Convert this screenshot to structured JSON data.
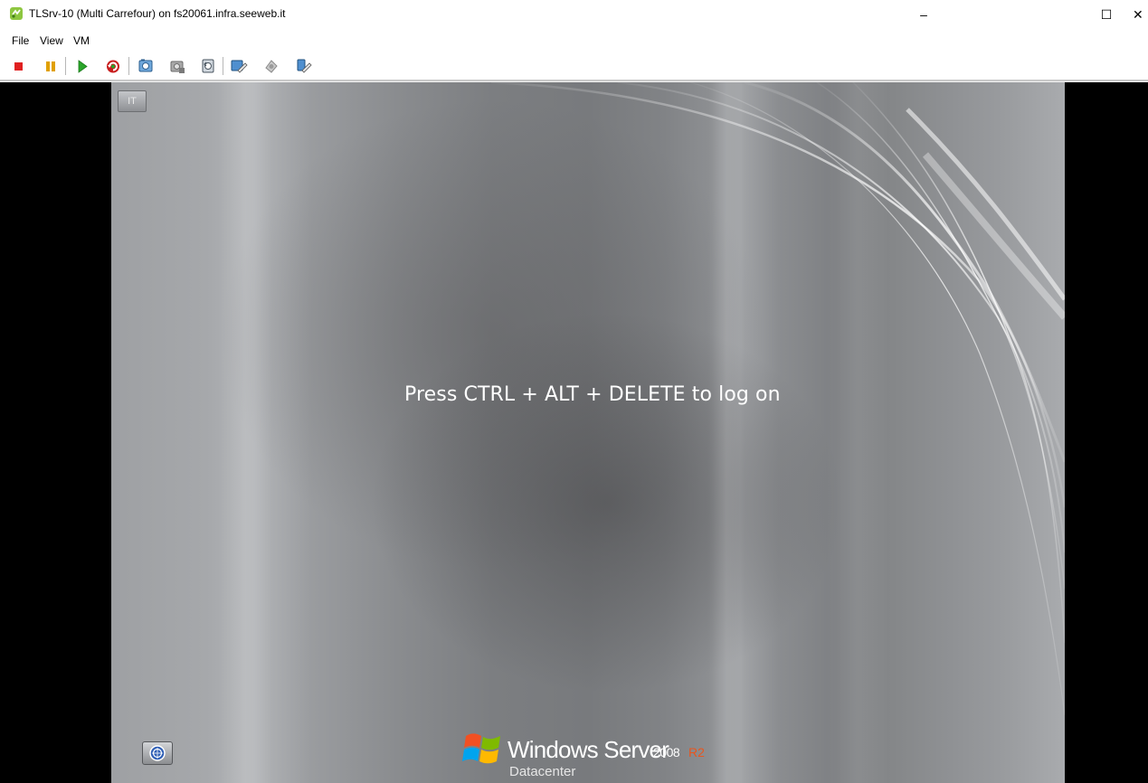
{
  "window": {
    "title": "TLSrv-10 (Multi Carrefour) on fs20061.infra.seeweb.it",
    "minimize_glyph": "–",
    "maximize_glyph": "☐",
    "close_glyph": "✕"
  },
  "menu": {
    "items": [
      {
        "label": "File"
      },
      {
        "label": "View"
      },
      {
        "label": "VM"
      }
    ]
  },
  "toolbar": {
    "buttons": [
      {
        "icon": "stop-icon",
        "color": "#e02020"
      },
      {
        "icon": "pause-icon",
        "color": "#e0a000"
      },
      {
        "icon": "play-icon",
        "color": "#2aa52a"
      },
      {
        "icon": "reset-icon",
        "color": "#c81e1e"
      },
      {
        "icon": "snapshot-icon"
      },
      {
        "icon": "snapshot-manager-icon"
      },
      {
        "icon": "revert-icon"
      },
      {
        "icon": "edit-settings-icon"
      },
      {
        "icon": "connect-device-icon"
      },
      {
        "icon": "device-settings-icon"
      }
    ]
  },
  "vm_screen": {
    "language_indicator": "IT",
    "logon_prompt": "Press CTRL + ALT + DELETE to log on",
    "brand": {
      "name": "Windows Server",
      "version": "2008",
      "release": "R2",
      "edition": "Datacenter",
      "release_color": "#e8561f"
    }
  }
}
